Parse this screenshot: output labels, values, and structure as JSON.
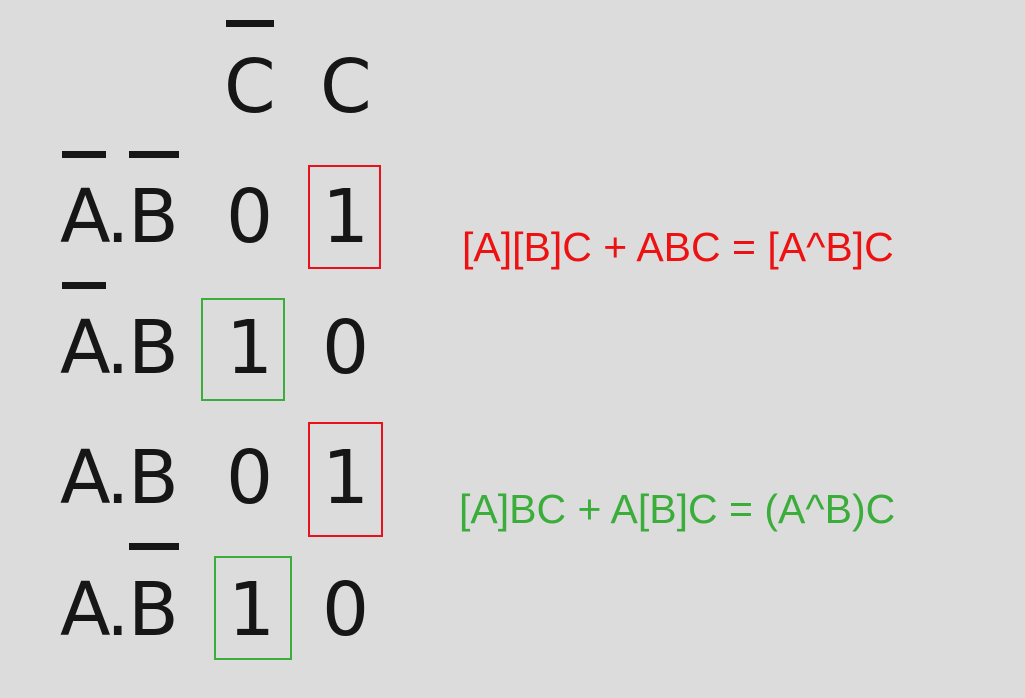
{
  "header": {
    "col_not_c": "C",
    "col_c": "C"
  },
  "rows": [
    {
      "a": "A",
      "dot": ".",
      "b": "B",
      "not_c": "0",
      "c": "1"
    },
    {
      "a": "A",
      "dot": ".",
      "b": "B",
      "not_c": "1",
      "c": "0"
    },
    {
      "a": "A",
      "dot": ".",
      "b": "B",
      "not_c": "0",
      "c": "1"
    },
    {
      "a": "A",
      "dot": ".",
      "b": "B",
      "not_c": "1",
      "c": "0"
    }
  ],
  "formulas": {
    "red": "[A][B]C + ABC = [A^B]C",
    "green": "[A]BC + A[B]C = (A^B)C"
  },
  "colors": {
    "red": "#ee1111",
    "green": "#3aad3a",
    "text": "#161616",
    "background": "#dcdcdc"
  }
}
